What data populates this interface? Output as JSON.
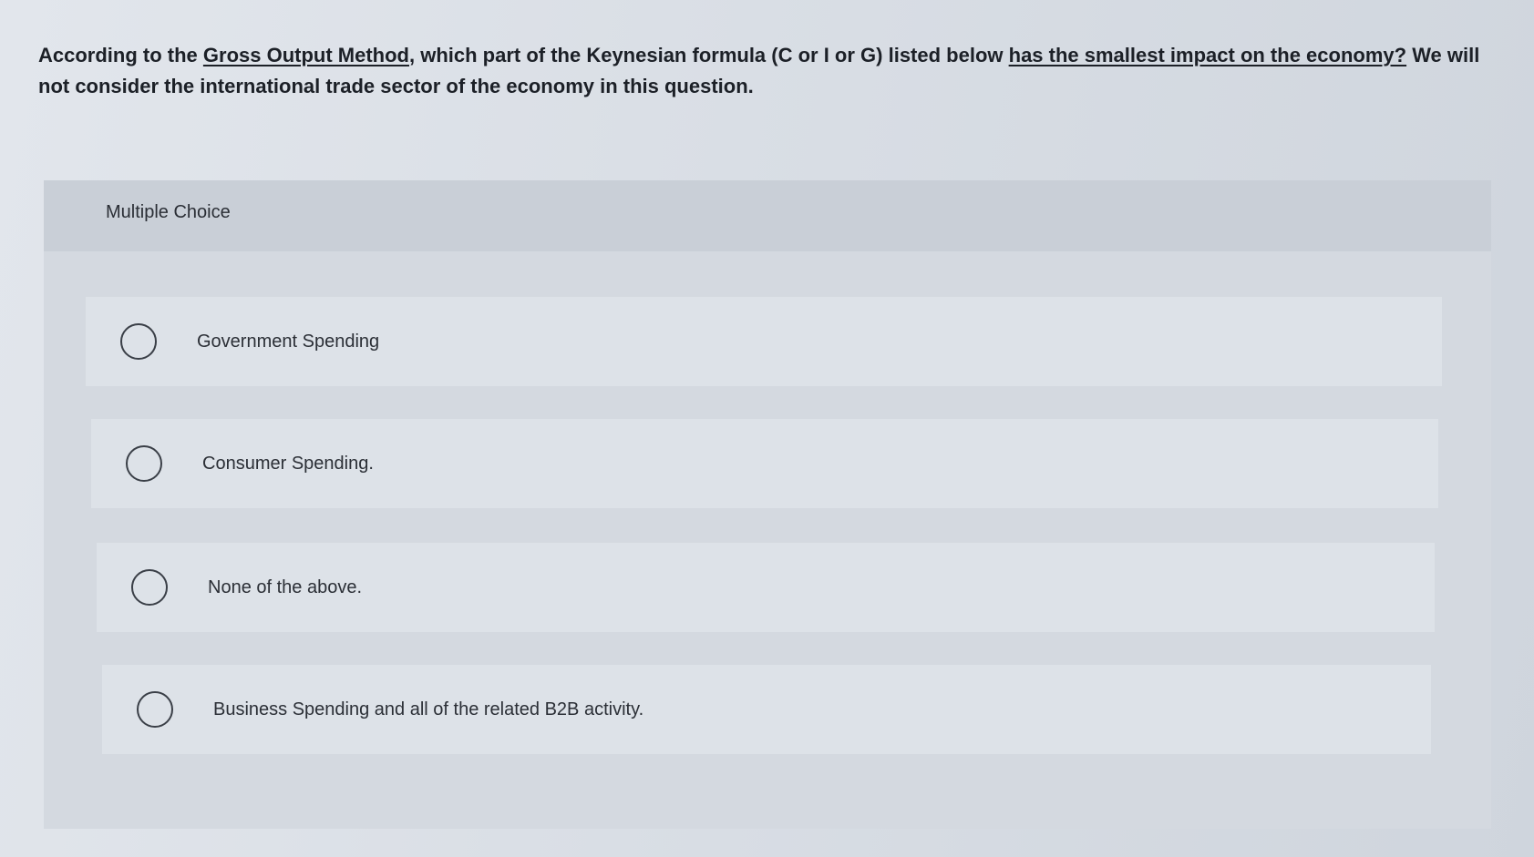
{
  "question": {
    "part1": "According to the ",
    "link1": "Gross Output Method",
    "part2": ", which part of the Keynesian formula (C or I or G) listed below ",
    "link2": "has the smallest impact on the economy?",
    "part3": " We will not consider the international trade sector of the economy in this question."
  },
  "panel": {
    "header_label": "Multiple Choice"
  },
  "options": [
    {
      "label": "Government Spending",
      "selected": false
    },
    {
      "label": "Consumer Spending.",
      "selected": false
    },
    {
      "label": "None of the above.",
      "selected": false
    },
    {
      "label": "Business Spending and all of the related B2B activity.",
      "selected": false
    }
  ],
  "colors": {
    "background": "#d9dee5",
    "panel": "#d4d9e0",
    "option_bg": "#dde2e8",
    "text": "#1f232a"
  }
}
